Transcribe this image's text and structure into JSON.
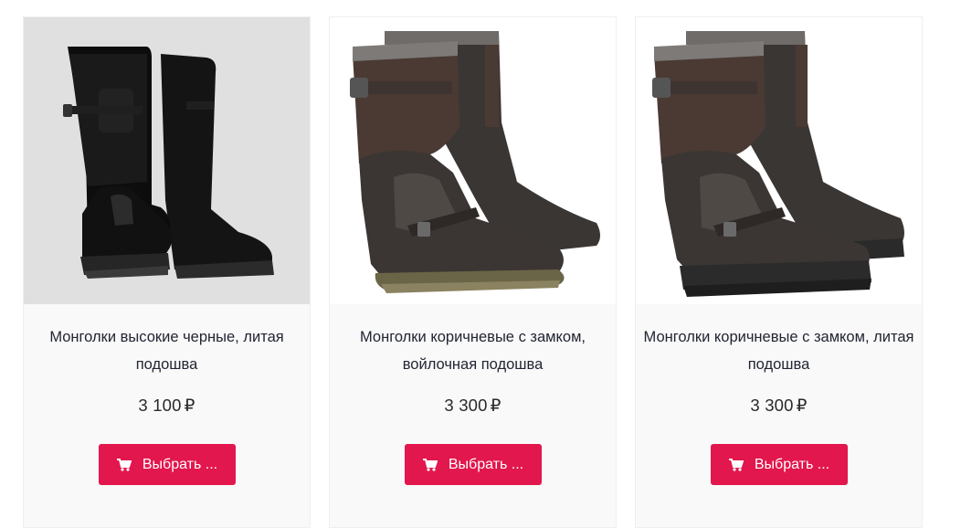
{
  "products": [
    {
      "title_line1": "Монголки высокие черные, литая",
      "title_line2": "подошва",
      "price": "3 100",
      "currency": "₽",
      "button_label": "Выбрать ...",
      "image_bg": "#e1e0e0"
    },
    {
      "title_line1": "Монголки коричневые с замком,",
      "title_line2": "войлочная подошва",
      "price": "3 300",
      "currency": "₽",
      "button_label": "Выбрать ...",
      "image_bg": "#ffffff"
    },
    {
      "title_line1": "Монголки коричневые с замком, литая",
      "title_line2": "подошва",
      "price": "3 300",
      "currency": "₽",
      "button_label": "Выбрать ...",
      "image_bg": "#ffffff"
    }
  ],
  "icons": {
    "button_icon": "cart-icon"
  },
  "colors": {
    "accent": "#e2174d",
    "card_bg": "#f9f9f9",
    "title_text": "#222533"
  }
}
